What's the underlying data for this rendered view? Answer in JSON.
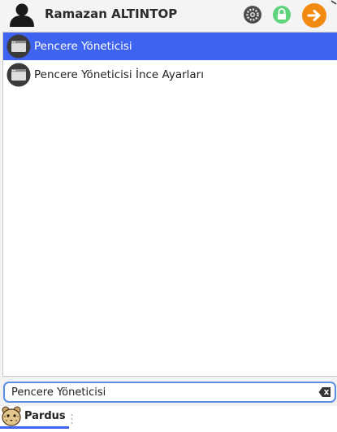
{
  "header": {
    "user_name": "Ramazan ALTINTOP",
    "icons": [
      "user-avatar-icon",
      "settings-icon",
      "lock-icon",
      "logout-arrow-icon"
    ]
  },
  "results": {
    "items": [
      {
        "label": "Pencere Yöneticisi",
        "icon": "window-app-icon",
        "selected": true
      },
      {
        "label": "Pencere Yöneticisi İnce Ayarları",
        "icon": "window-app-icon",
        "selected": false
      }
    ]
  },
  "search": {
    "value": "Pencere Yöneticisi",
    "clear_icon": "backspace-clear-icon"
  },
  "taskbar": {
    "menu_label": "Pardus",
    "logo_icon": "pardus-leopard-icon"
  },
  "colors": {
    "selection": "#3d63f0",
    "search_border": "#5b8de0",
    "lock": "#5fd47c",
    "logout": "#f28a12"
  }
}
